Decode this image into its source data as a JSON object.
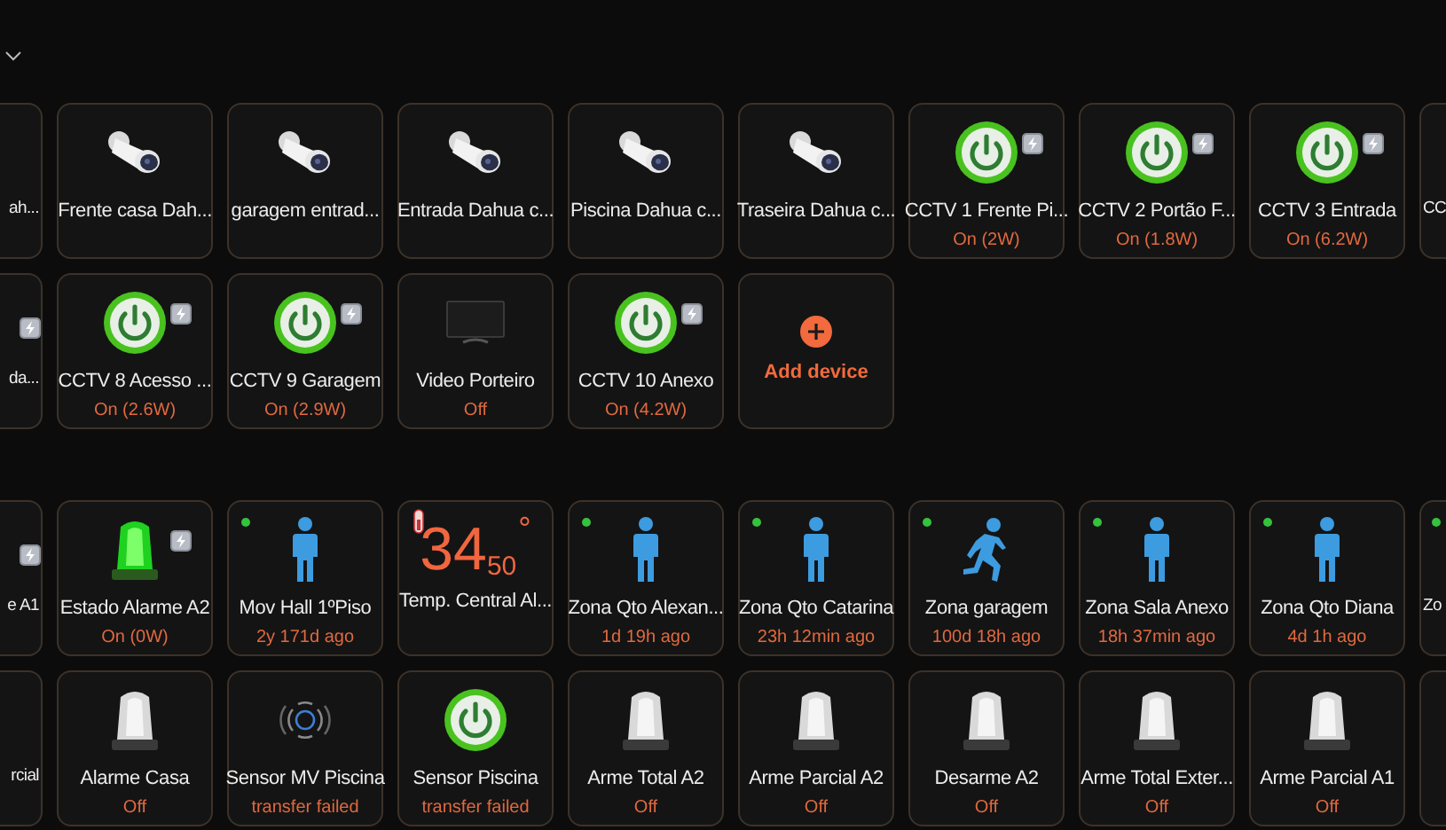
{
  "groups": [
    {
      "rows": [
        {
          "tiles": [
            {
              "kind": "partial_left",
              "name": "ah...",
              "badge": false
            },
            {
              "kind": "camera",
              "name": "Frente casa Dah..."
            },
            {
              "kind": "camera",
              "name": "garagem entrad..."
            },
            {
              "kind": "camera",
              "name": "Entrada Dahua c..."
            },
            {
              "kind": "camera",
              "name": "Piscina Dahua c..."
            },
            {
              "kind": "camera",
              "name": "Traseira Dahua c..."
            },
            {
              "kind": "switch",
              "name": "CCTV 1 Frente Pi...",
              "status": "On (2W)",
              "on": true,
              "badge": true
            },
            {
              "kind": "switch",
              "name": "CCTV 2 Portão F...",
              "status": "On (1.8W)",
              "on": true,
              "badge": true
            },
            {
              "kind": "switch",
              "name": "CCTV 3 Entrada",
              "status": "On (6.2W)",
              "on": true,
              "badge": true
            },
            {
              "kind": "partial_right",
              "name": "CC"
            }
          ]
        },
        {
          "tiles": [
            {
              "kind": "partial_left",
              "name": "da...",
              "badge": true
            },
            {
              "kind": "switch",
              "name": "CCTV 8 Acesso ...",
              "status": "On (2.6W)",
              "on": true,
              "badge": true
            },
            {
              "kind": "switch",
              "name": "CCTV 9 Garagem",
              "status": "On (2.9W)",
              "on": true,
              "badge": true
            },
            {
              "kind": "tv",
              "name": "Video Porteiro",
              "status": "Off"
            },
            {
              "kind": "switch",
              "name": "CCTV 10 Anexo",
              "status": "On (4.2W)",
              "on": true,
              "badge": true
            },
            {
              "kind": "add",
              "name": "Add device"
            }
          ]
        }
      ]
    },
    {
      "rows": [
        {
          "tiles": [
            {
              "kind": "partial_left",
              "name": "e A1",
              "badge": true
            },
            {
              "kind": "siren",
              "name": "Estado Alarme A2",
              "status": "On (0W)",
              "on": true,
              "badge": true
            },
            {
              "kind": "motion",
              "name": "Mov Hall 1ºPiso",
              "status": "2y 171d ago",
              "running": false,
              "dot": true
            },
            {
              "kind": "temp",
              "name": "Temp. Central Al...",
              "value": "34",
              "decimal": "50",
              "unit": "°"
            },
            {
              "kind": "motion",
              "name": "Zona Qto Alexan...",
              "status": "1d 19h ago",
              "running": false,
              "dot": true
            },
            {
              "kind": "motion",
              "name": "Zona Qto Catarina",
              "status": "23h 12min ago",
              "running": false,
              "dot": true
            },
            {
              "kind": "motion",
              "name": "Zona garagem",
              "status": "100d 18h ago",
              "running": true,
              "dot": true
            },
            {
              "kind": "motion",
              "name": "Zona Sala Anexo",
              "status": "18h 37min ago",
              "running": false,
              "dot": true
            },
            {
              "kind": "motion",
              "name": "Zona Qto Diana",
              "status": "4d 1h ago",
              "running": false,
              "dot": true
            },
            {
              "kind": "partial_right",
              "name": "Zo",
              "dot": true
            }
          ]
        },
        {
          "tiles": [
            {
              "kind": "partial_left",
              "name": "rcial",
              "badge": false
            },
            {
              "kind": "siren",
              "name": "Alarme Casa",
              "status": "Off",
              "on": false,
              "badge": false
            },
            {
              "kind": "sensor",
              "name": "Sensor MV Piscina",
              "status": "transfer failed"
            },
            {
              "kind": "switch",
              "name": "Sensor Piscina",
              "status": "transfer failed",
              "on": true,
              "badge": false
            },
            {
              "kind": "siren",
              "name": "Arme Total A2",
              "status": "Off",
              "on": false,
              "badge": false
            },
            {
              "kind": "siren",
              "name": "Arme Parcial A2",
              "status": "Off",
              "on": false,
              "badge": false
            },
            {
              "kind": "siren",
              "name": "Desarme A2",
              "status": "Off",
              "on": false,
              "badge": false
            },
            {
              "kind": "siren",
              "name": "Arme Total Exter...",
              "status": "Off",
              "on": false,
              "badge": false
            },
            {
              "kind": "siren",
              "name": "Arme Parcial A1",
              "status": "Off",
              "on": false,
              "badge": false
            },
            {
              "kind": "partial_right"
            }
          ]
        }
      ]
    }
  ]
}
